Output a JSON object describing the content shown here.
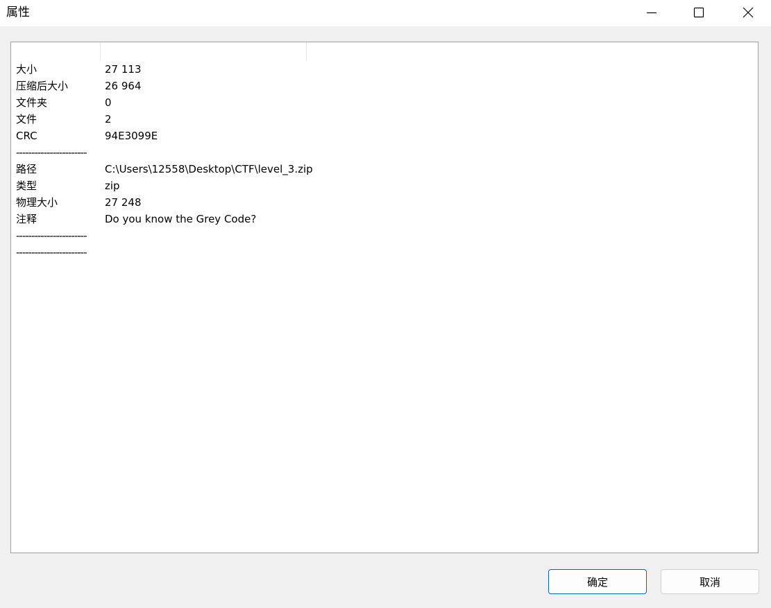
{
  "window": {
    "title": "属性",
    "controls": [
      "minimize-icon",
      "maximize-icon",
      "close-icon"
    ]
  },
  "properties": [
    {
      "key": "大小",
      "value": "27 113"
    },
    {
      "key": "压缩后大小",
      "value": "26 964"
    },
    {
      "key": "文件夹",
      "value": "0"
    },
    {
      "key": "文件",
      "value": "2"
    },
    {
      "key": "CRC",
      "value": "94E3099E"
    },
    {
      "separator": "-----------------------"
    },
    {
      "key": "路径",
      "value": "C:\\Users\\12558\\Desktop\\CTF\\level_3.zip"
    },
    {
      "key": "类型",
      "value": "zip"
    },
    {
      "key": "物理大小",
      "value": "27 248"
    },
    {
      "key": "注释",
      "value": "Do you know the Grey Code?"
    },
    {
      "separator": "-----------------------"
    },
    {
      "separator": "-----------------------"
    }
  ],
  "buttons": {
    "ok_label": "确定",
    "cancel_label": "取消"
  },
  "colors": {
    "background": "#f0f0f0",
    "accent": "#0067c0"
  }
}
